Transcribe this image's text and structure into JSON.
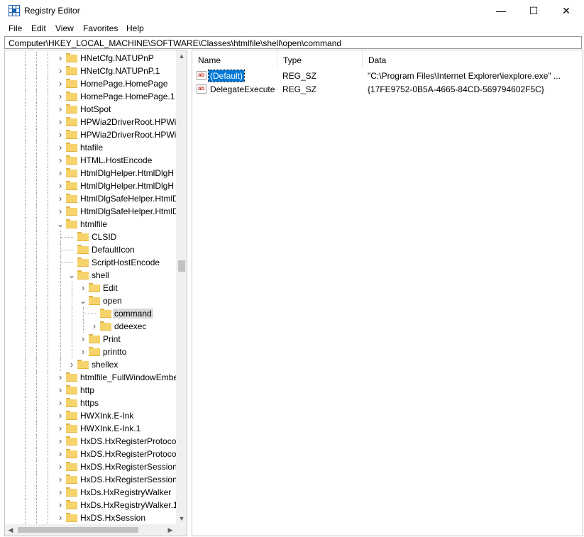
{
  "window": {
    "title": "Registry Editor",
    "minimize_glyph": "—",
    "maximize_glyph": "☐",
    "close_glyph": "✕"
  },
  "menu": [
    "File",
    "Edit",
    "View",
    "Favorites",
    "Help"
  ],
  "address": "Computer\\HKEY_LOCAL_MACHINE\\SOFTWARE\\Classes\\htmlfile\\shell\\open\\command",
  "tree": [
    {
      "label": "HNetCfg.NATUPnP",
      "depth": 0,
      "expander": "collapsed"
    },
    {
      "label": "HNetCfg.NATUPnP.1",
      "depth": 0,
      "expander": "collapsed"
    },
    {
      "label": "HomePage.HomePage",
      "depth": 0,
      "expander": "collapsed"
    },
    {
      "label": "HomePage.HomePage.1",
      "depth": 0,
      "expander": "collapsed"
    },
    {
      "label": "HotSpot",
      "depth": 0,
      "expander": "collapsed"
    },
    {
      "label": "HPWia2DriverRoot.HPWia",
      "depth": 0,
      "expander": "collapsed"
    },
    {
      "label": "HPWia2DriverRoot.HPWia",
      "depth": 0,
      "expander": "collapsed"
    },
    {
      "label": "htafile",
      "depth": 0,
      "expander": "collapsed"
    },
    {
      "label": "HTML.HostEncode",
      "depth": 0,
      "expander": "collapsed"
    },
    {
      "label": "HtmlDlgHelper.HtmlDlgH",
      "depth": 0,
      "expander": "collapsed"
    },
    {
      "label": "HtmlDlgHelper.HtmlDlgH",
      "depth": 0,
      "expander": "collapsed"
    },
    {
      "label": "HtmlDlgSafeHelper.HtmlD",
      "depth": 0,
      "expander": "collapsed"
    },
    {
      "label": "HtmlDlgSafeHelper.HtmlD",
      "depth": 0,
      "expander": "collapsed"
    },
    {
      "label": "htmlfile",
      "depth": 0,
      "expander": "expanded"
    },
    {
      "label": "CLSID",
      "depth": 1,
      "expander": "none"
    },
    {
      "label": "DefaultIcon",
      "depth": 1,
      "expander": "none"
    },
    {
      "label": "ScriptHostEncode",
      "depth": 1,
      "expander": "none"
    },
    {
      "label": "shell",
      "depth": 1,
      "expander": "expanded"
    },
    {
      "label": "Edit",
      "depth": 2,
      "expander": "collapsed"
    },
    {
      "label": "open",
      "depth": 2,
      "expander": "expanded"
    },
    {
      "label": "command",
      "depth": 3,
      "expander": "none",
      "selected": true
    },
    {
      "label": "ddeexec",
      "depth": 3,
      "expander": "collapsed"
    },
    {
      "label": "Print",
      "depth": 2,
      "expander": "collapsed"
    },
    {
      "label": "printto",
      "depth": 2,
      "expander": "collapsed"
    },
    {
      "label": "shellex",
      "depth": 1,
      "expander": "collapsed"
    },
    {
      "label": "htmlfile_FullWindowEmbe",
      "depth": 0,
      "expander": "collapsed"
    },
    {
      "label": "http",
      "depth": 0,
      "expander": "collapsed"
    },
    {
      "label": "https",
      "depth": 0,
      "expander": "collapsed"
    },
    {
      "label": "HWXInk.E-Ink",
      "depth": 0,
      "expander": "collapsed"
    },
    {
      "label": "HWXInk.E-Ink.1",
      "depth": 0,
      "expander": "collapsed"
    },
    {
      "label": "HxDS.HxRegisterProtocol",
      "depth": 0,
      "expander": "collapsed"
    },
    {
      "label": "HxDS.HxRegisterProtocol.",
      "depth": 0,
      "expander": "collapsed"
    },
    {
      "label": "HxDS.HxRegisterSession",
      "depth": 0,
      "expander": "collapsed"
    },
    {
      "label": "HxDS.HxRegisterSession.1",
      "depth": 0,
      "expander": "collapsed"
    },
    {
      "label": "HxDs.HxRegistryWalker",
      "depth": 0,
      "expander": "collapsed"
    },
    {
      "label": "HxDs.HxRegistryWalker.1",
      "depth": 0,
      "expander": "collapsed"
    },
    {
      "label": "HxDS.HxSession",
      "depth": 0,
      "expander": "collapsed"
    }
  ],
  "columns": {
    "name": "Name",
    "type": "Type",
    "data": "Data"
  },
  "values": [
    {
      "name": "(Default)",
      "type": "REG_SZ",
      "data": "\"C:\\Program Files\\Internet Explorer\\iexplore.exe\" ...",
      "selected": true
    },
    {
      "name": "DelegateExecute",
      "type": "REG_SZ",
      "data": "{17FE9752-0B5A-4665-84CD-569794602F5C}"
    }
  ],
  "icons": {
    "app": "registry-icon",
    "folder": "folder-icon",
    "string_value": "ab-icon"
  },
  "colors": {
    "selection": "#0078d7",
    "folder": "#f6d36b",
    "tree_selected": "#d9d9d9"
  }
}
